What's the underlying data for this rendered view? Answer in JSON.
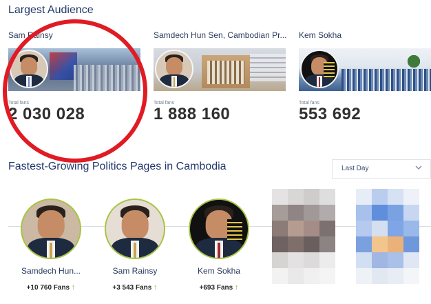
{
  "sections": {
    "largest_title": "Largest Audience",
    "fastest_title": "Fastest-Growing Politics Pages in Cambodia"
  },
  "largest": [
    {
      "name": "Sam Rainsy",
      "label": "Total fans",
      "fans": "2 030 028"
    },
    {
      "name": "Samdech Hun Sen, Cambodian Pr...",
      "label": "Total fans",
      "fans": "1 888 160"
    },
    {
      "name": "Kem Sokha",
      "label": "Total fans",
      "fans": "553 692"
    }
  ],
  "period_select": {
    "value": "Last Day"
  },
  "fastest": [
    {
      "name": "Samdech Hun...",
      "fans": "+10 760 Fans"
    },
    {
      "name": "Sam Rainsy",
      "fans": "+3 543 Fans"
    },
    {
      "name": "Kem Sokha",
      "fans": "+693 Fans"
    }
  ],
  "icons": {
    "up_arrow": "↑",
    "chevron": "chevron-down-icon"
  },
  "colors": {
    "highlight_circle": "#e01b24",
    "title_color": "#23386b",
    "growth_arrow": "#8bb33a",
    "avatar_ring": "#a7c444"
  }
}
